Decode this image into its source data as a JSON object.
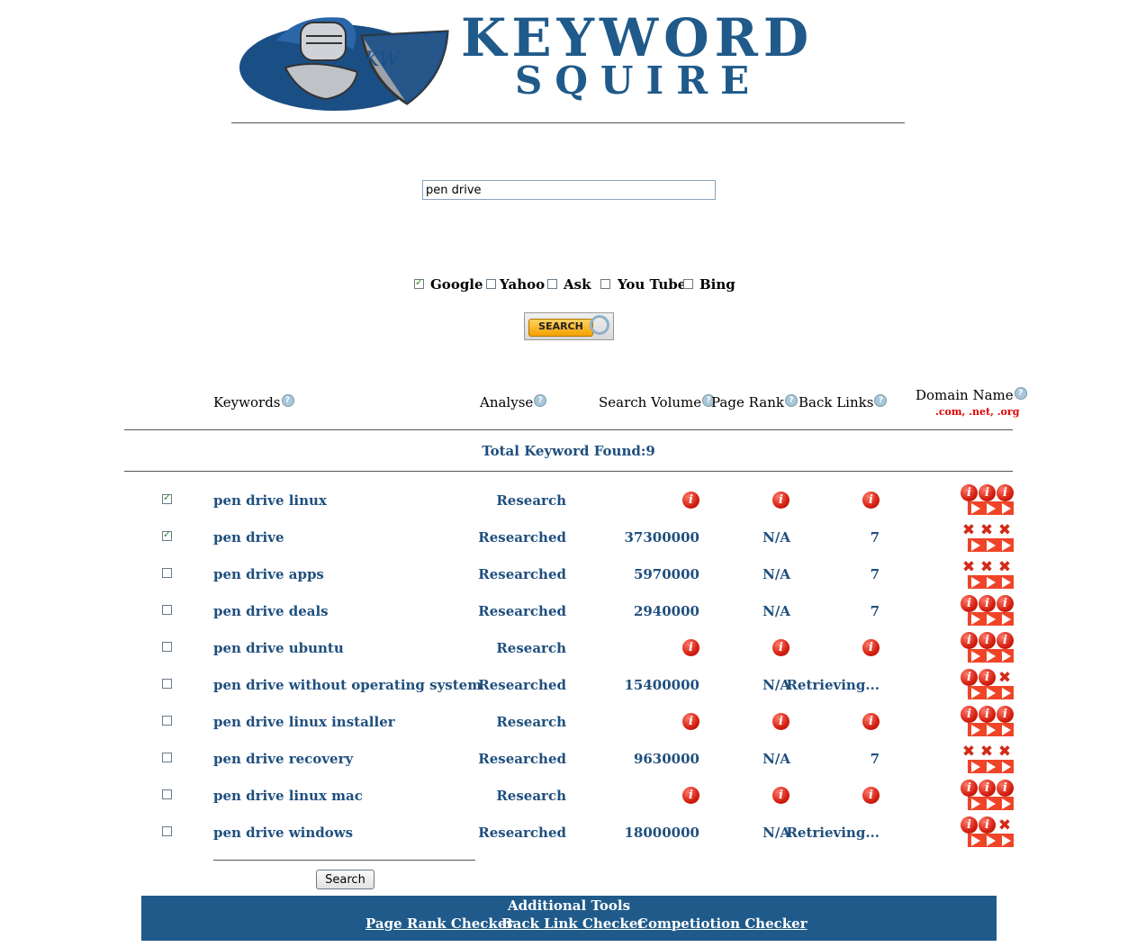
{
  "brand": {
    "title_line1": "KEYWORD",
    "title_line2": "SQUIRE",
    "shield_text": "KW"
  },
  "search": {
    "value": "pen drive",
    "button_label": "SEARCH"
  },
  "engines": [
    {
      "label": "Google",
      "checked": true
    },
    {
      "label": "Yahoo",
      "checked": false
    },
    {
      "label": "Ask",
      "checked": false
    },
    {
      "label": "You Tube",
      "checked": false
    },
    {
      "label": "Bing",
      "checked": false
    }
  ],
  "table": {
    "headers": {
      "keywords": "Keywords",
      "analyse": "Analyse",
      "search_volume": "Search Volume",
      "page_rank": "Page Rank",
      "back_links": "Back Links",
      "domain_name": "Domain Name",
      "domain_ext": ".com, .net, .org"
    },
    "total": "Total Keyword Found:9",
    "rows": [
      {
        "checked": true,
        "keyword": "pen drive linux",
        "analyse": "Research",
        "volume": null,
        "rank": null,
        "links": null,
        "domains": [
          "i",
          "i",
          "i"
        ]
      },
      {
        "checked": true,
        "keyword": "pen drive",
        "analyse": "Researched",
        "volume": "37300000",
        "rank": "N/A",
        "links": "7",
        "domains": [
          "x",
          "x",
          "x"
        ]
      },
      {
        "checked": false,
        "keyword": "pen drive apps",
        "analyse": "Researched",
        "volume": "5970000",
        "rank": "N/A",
        "links": "7",
        "domains": [
          "x",
          "x",
          "x"
        ]
      },
      {
        "checked": false,
        "keyword": "pen drive deals",
        "analyse": "Researched",
        "volume": "2940000",
        "rank": "N/A",
        "links": "7",
        "domains": [
          "i",
          "i",
          "i"
        ]
      },
      {
        "checked": false,
        "keyword": "pen drive ubuntu",
        "analyse": "Research",
        "volume": null,
        "rank": null,
        "links": null,
        "domains": [
          "i",
          "i",
          "i"
        ]
      },
      {
        "checked": false,
        "keyword": "pen drive without operating system",
        "analyse": "Researched",
        "volume": "15400000",
        "rank": "N/A",
        "links": "Retrieving...",
        "domains": [
          "i",
          "i",
          "x"
        ]
      },
      {
        "checked": false,
        "keyword": "pen drive linux installer",
        "analyse": "Research",
        "volume": null,
        "rank": null,
        "links": null,
        "domains": [
          "i",
          "i",
          "i"
        ]
      },
      {
        "checked": false,
        "keyword": "pen drive recovery",
        "analyse": "Researched",
        "volume": "9630000",
        "rank": "N/A",
        "links": "7",
        "domains": [
          "x",
          "x",
          "x"
        ]
      },
      {
        "checked": false,
        "keyword": "pen drive linux mac",
        "analyse": "Research",
        "volume": null,
        "rank": null,
        "links": null,
        "domains": [
          "i",
          "i",
          "i"
        ]
      },
      {
        "checked": false,
        "keyword": "pen drive windows",
        "analyse": "Researched",
        "volume": "18000000",
        "rank": "N/A",
        "links": "Retrieving...",
        "domains": [
          "i",
          "i",
          "x"
        ]
      }
    ],
    "bottom_search_label": "Search"
  },
  "footer": {
    "title": "Additional Tools",
    "links": [
      "Page Rank Checker",
      "Back Link Checker",
      "Competiotion Checker"
    ]
  },
  "colors": {
    "text_blue": "#1f4f7e",
    "footer_bg": "#1f5a8a",
    "info_red": "#d41f10",
    "arrow_red": "#f04428"
  }
}
